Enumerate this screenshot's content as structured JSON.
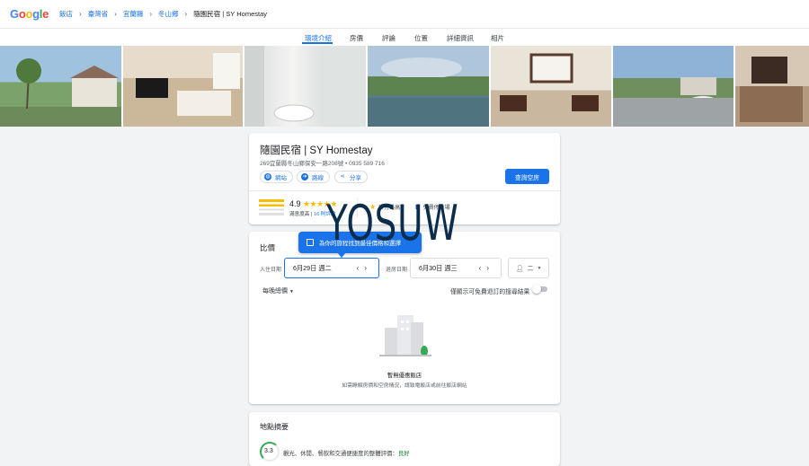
{
  "topbar": {
    "logo": "Google",
    "crumbs": [
      "飯店",
      "臺灣省",
      "宜蘭縣",
      "冬山鄉"
    ],
    "current": "隨園民宿 | SY Homestay"
  },
  "tabs": [
    {
      "label": "環境介紹",
      "active": true
    },
    {
      "label": "房價"
    },
    {
      "label": "評論"
    },
    {
      "label": "位置"
    },
    {
      "label": "詳細資訊"
    },
    {
      "label": "相片"
    }
  ],
  "hotel": {
    "name": "隨園民宿 | SY Homestay",
    "address": "269宜蘭縣冬山鄉保安一路208號 • 0935 589 716",
    "buttons": {
      "website": "網站",
      "directions": "路線",
      "share": "分享"
    },
    "check_button": "查詢空房",
    "rating": "4.9",
    "stars": "★★★★★",
    "rating_label": "滿意度高",
    "review_count": "16 則評論",
    "amenity1": "評分最高",
    "amenity2": "免費停車場"
  },
  "watermark": "YOSUW",
  "price": {
    "title": "比價",
    "tip": "為你的旅程找到最佳價格和選擇",
    "checkin_label": "入住日期",
    "checkin_value": "6月29日 週二",
    "checkout_label": "退房日期",
    "checkout_value": "6月30日 週三",
    "guests": "二",
    "nightly": "每晚總價",
    "free_cancel": "僅顯示可免費退訂的搜尋結果",
    "no_deal_title": "暫無優惠飯店",
    "no_deal_text": "如需瞭解房價和空房情況，請致電飯店或前往飯店網站"
  },
  "location": {
    "title": "地點摘要",
    "score": "3.3",
    "text_prefix": "觀光、休閒、餐飲和交通便捷度的整體評價：",
    "text_rating": "良好"
  },
  "colors": {
    "accent": "#1a73e8",
    "star": "#fbbc04",
    "good": "#34a853"
  }
}
